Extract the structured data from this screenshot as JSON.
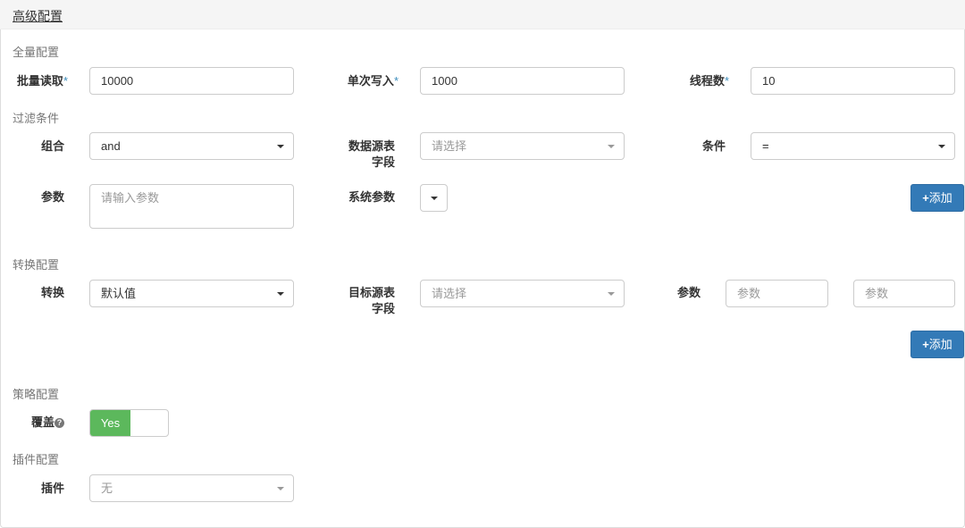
{
  "title": "高级配置",
  "full": {
    "section": "全量配置",
    "batch_read_label": "批量读取",
    "batch_read": "10000",
    "single_write_label": "单次写入",
    "single_write": "1000",
    "threads_label": "线程数",
    "threads": "10",
    "required_mark": "*"
  },
  "filter": {
    "section": "过滤条件",
    "combine_label": "组合",
    "combine": "and",
    "source_field_label_1": "数据源表",
    "source_field_label_2": "字段",
    "source_field_placeholder": "请选择",
    "condition_label": "条件",
    "condition": "=",
    "param_label": "参数",
    "param_placeholder": "请输入参数",
    "sys_param_label": "系统参数",
    "add": "添加"
  },
  "transform": {
    "section": "转换配置",
    "transform_label": "转换",
    "transform": "默认值",
    "target_field_label_1": "目标源表",
    "target_field_label_2": "字段",
    "target_field_placeholder": "请选择",
    "param_label": "参数",
    "param1_placeholder": "参数",
    "param2_placeholder": "参数",
    "add": "添加"
  },
  "strategy": {
    "section": "策略配置",
    "override_label": "覆盖",
    "override": "Yes",
    "on_color": "#5cb85c"
  },
  "plugin": {
    "section": "插件配置",
    "plugin_label": "插件",
    "plugin": "无"
  }
}
